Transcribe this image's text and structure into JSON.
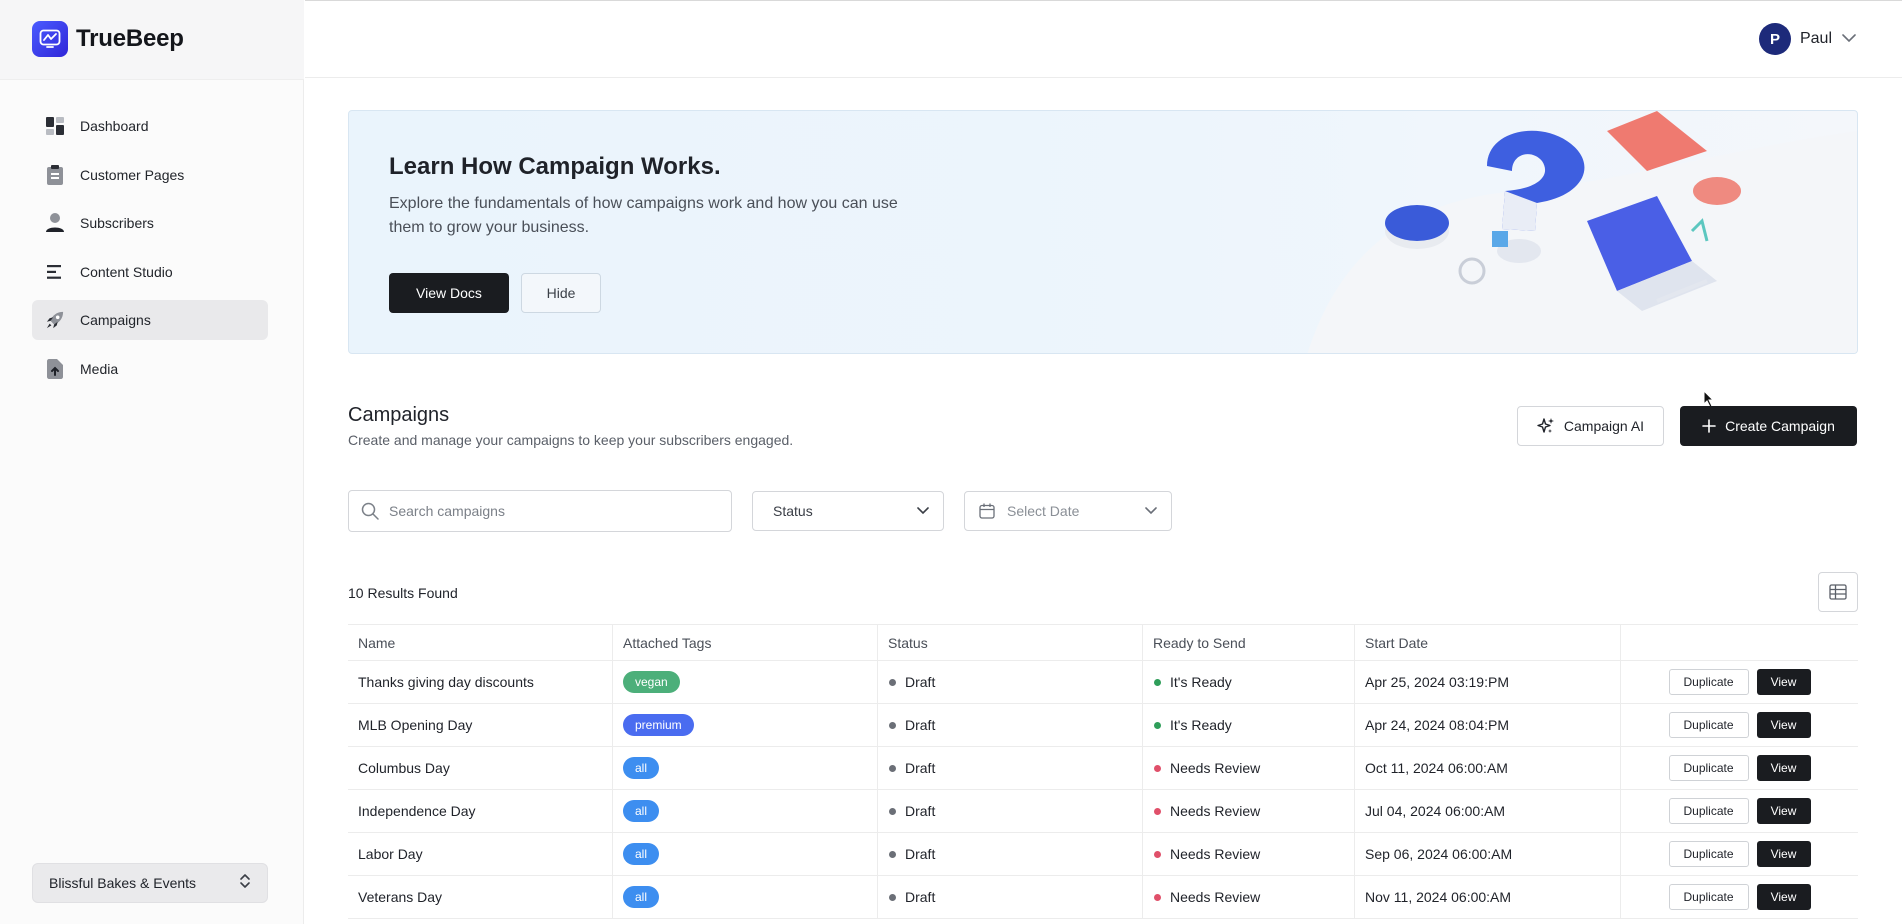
{
  "app": {
    "name": "TrueBeep"
  },
  "user": {
    "initial": "P",
    "name": "Paul"
  },
  "sidebar": {
    "items": [
      {
        "label": "Dashboard",
        "icon": "dashboard-icon"
      },
      {
        "label": "Customer Pages",
        "icon": "clipboard-icon"
      },
      {
        "label": "Subscribers",
        "icon": "user-icon"
      },
      {
        "label": "Content Studio",
        "icon": "lines-icon"
      },
      {
        "label": "Campaigns",
        "icon": "rocket-icon",
        "active": true
      },
      {
        "label": "Media",
        "icon": "file-upload-icon"
      }
    ],
    "org": "Blissful Bakes & Events"
  },
  "banner": {
    "title": "Learn How Campaign Works.",
    "description": "Explore the fundamentals of how campaigns work and how you can use them to grow your business.",
    "primary": "View Docs",
    "secondary": "Hide"
  },
  "campaigns": {
    "title": "Campaigns",
    "subtitle": "Create and manage your campaigns to keep your subscribers engaged.",
    "ai_button": "Campaign AI",
    "create_button": "Create Campaign",
    "search_placeholder": "Search campaigns",
    "status_filter": "Status",
    "date_filter": "Select Date",
    "results": "10 Results Found"
  },
  "table": {
    "headers": [
      "Name",
      "Attached Tags",
      "Status",
      "Ready to Send",
      "Start Date",
      ""
    ],
    "duplicate_label": "Duplicate",
    "view_label": "View",
    "rows": [
      {
        "name": "Thanks giving day discounts",
        "tag": "vegan",
        "tag_color": "#4caf7a",
        "status": "Draft",
        "ready": "It's Ready",
        "ready_color": "#2f9e5a",
        "start": "Apr 25, 2024 03:19:PM"
      },
      {
        "name": "MLB Opening Day",
        "tag": "premium",
        "tag_color": "#4a6cf0",
        "status": "Draft",
        "ready": "It's Ready",
        "ready_color": "#2f9e5a",
        "start": "Apr 24, 2024 08:04:PM"
      },
      {
        "name": "Columbus Day",
        "tag": "all",
        "tag_color": "#3d8ef0",
        "status": "Draft",
        "ready": "Needs Review",
        "ready_color": "#e0506a",
        "start": "Oct 11, 2024 06:00:AM"
      },
      {
        "name": "Independence Day",
        "tag": "all",
        "tag_color": "#3d8ef0",
        "status": "Draft",
        "ready": "Needs Review",
        "ready_color": "#e0506a",
        "start": "Jul 04, 2024 06:00:AM"
      },
      {
        "name": "Labor Day",
        "tag": "all",
        "tag_color": "#3d8ef0",
        "status": "Draft",
        "ready": "Needs Review",
        "ready_color": "#e0506a",
        "start": "Sep 06, 2024 06:00:AM"
      },
      {
        "name": "Veterans Day",
        "tag": "all",
        "tag_color": "#3d8ef0",
        "status": "Draft",
        "ready": "Needs Review",
        "ready_color": "#e0506a",
        "start": "Nov 11, 2024 06:00:AM"
      }
    ]
  }
}
